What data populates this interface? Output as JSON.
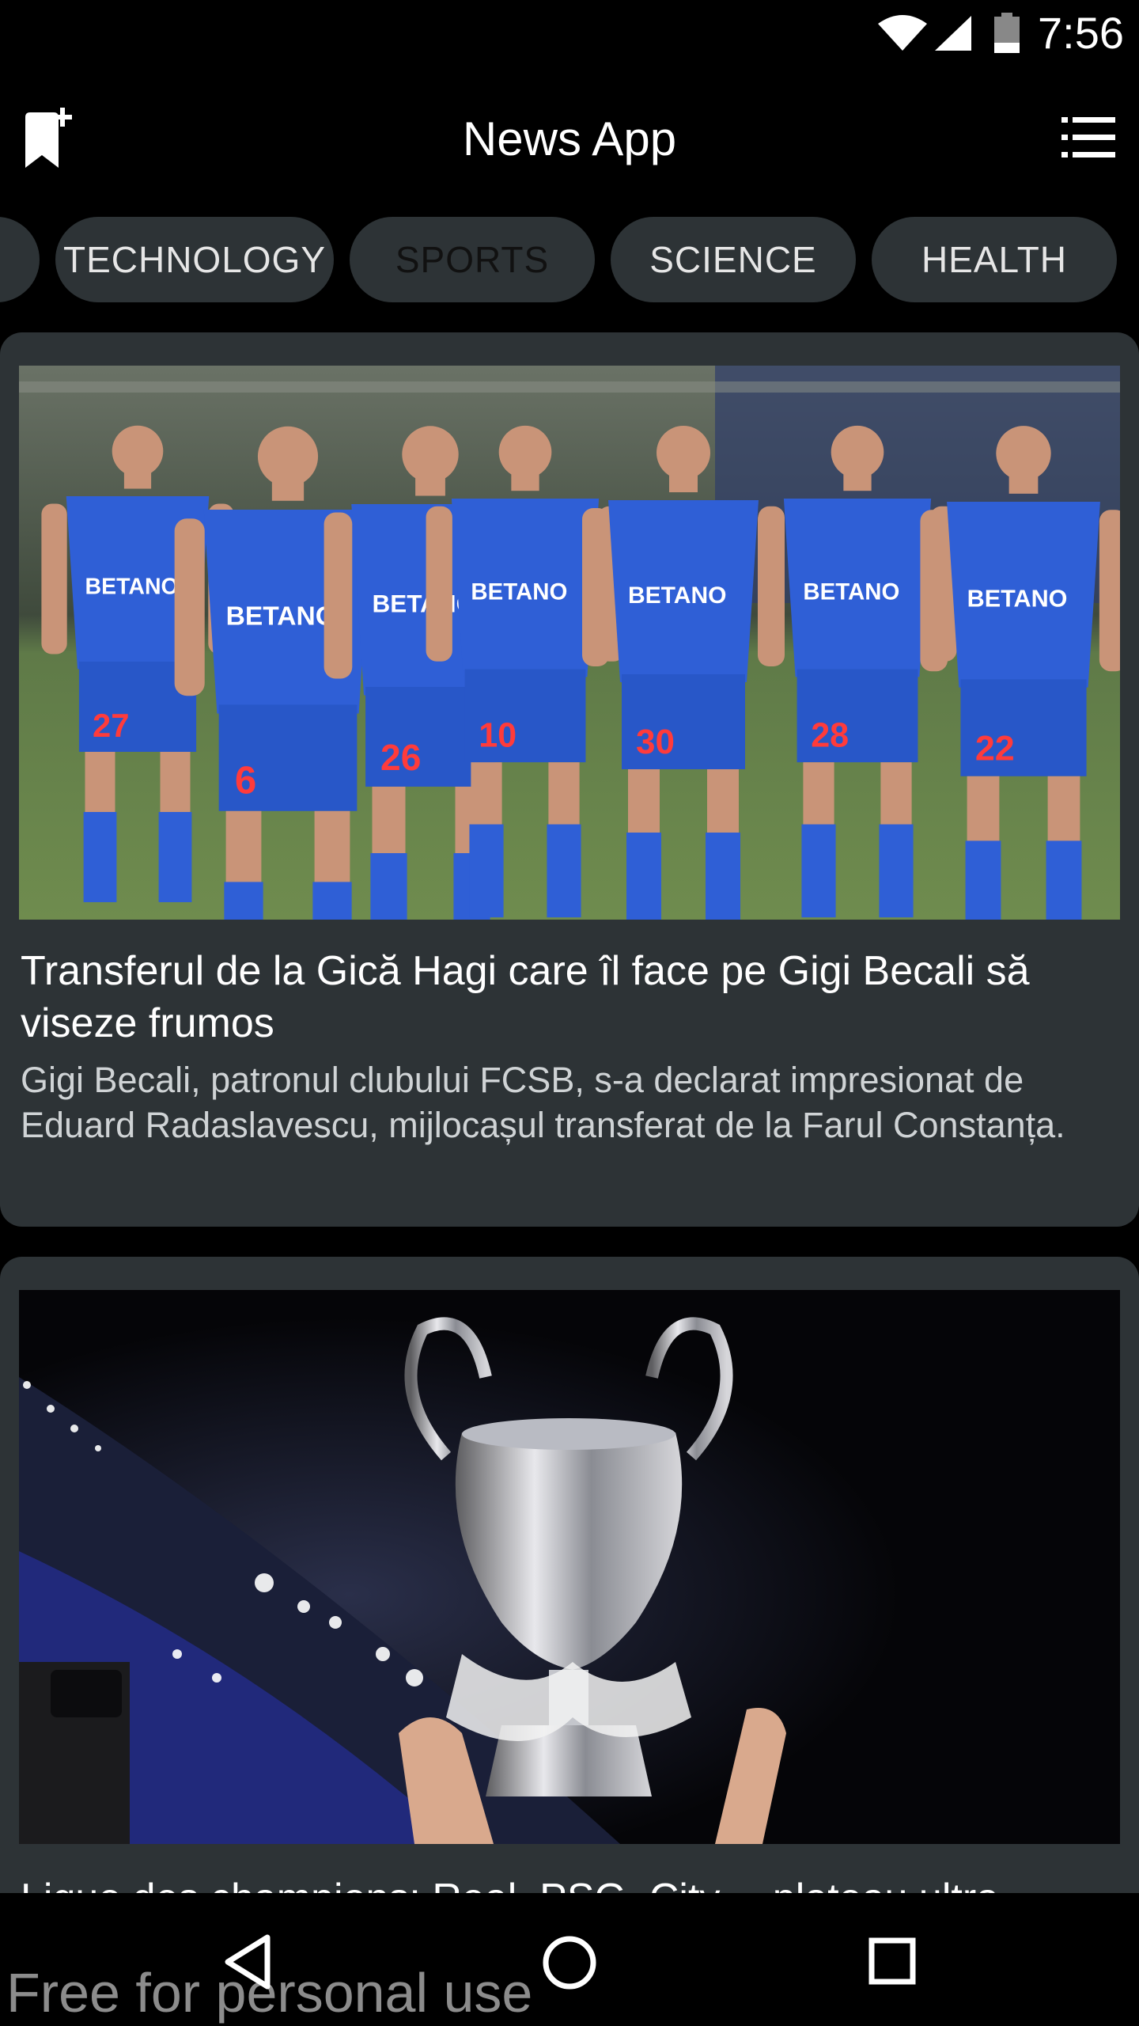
{
  "status_bar": {
    "time": "7:56"
  },
  "app_bar": {
    "title": "News App"
  },
  "categories": [
    {
      "label": "TECHNOLOGY",
      "active": false
    },
    {
      "label": "SPORTS",
      "active": true
    },
    {
      "label": "SCIENCE",
      "active": false
    },
    {
      "label": "HEALTH",
      "active": false
    }
  ],
  "articles": [
    {
      "title": "Transferul de la Gică Hagi care îl face pe Gigi Becali să viseze frumos",
      "description": "Gigi Becali, patronul clubului FCSB, s-a declarat impresionat de Eduard Radaslavescu, mijlocașul transferat de la Farul Constanța.",
      "image_alt": "Football players in blue kits walking on a pitch",
      "jersey_sponsor": "BETANO",
      "jersey_numbers": [
        "27",
        "6",
        "26",
        "10",
        "30",
        "28",
        "22"
      ]
    },
    {
      "title": "Ligue des champions: Real, PSG, City… plateau ultra",
      "image_alt": "Champions League trophy held up in a stadium at night"
    }
  ],
  "watermark": "Free for personal use",
  "colors": {
    "background": "#000000",
    "card": "#2d3336",
    "chip": "#2d3336",
    "text_primary": "#ffffff",
    "text_secondary": "#cfd3d5",
    "kit_blue": "#2f5fd6"
  },
  "icons": {
    "bookmark": "bookmark-add-icon",
    "menu": "list-menu-icon",
    "wifi": "wifi-icon",
    "signal": "signal-icon",
    "battery": "battery-icon",
    "back": "back-triangle-icon",
    "home": "home-circle-icon",
    "recents": "recents-square-icon"
  }
}
